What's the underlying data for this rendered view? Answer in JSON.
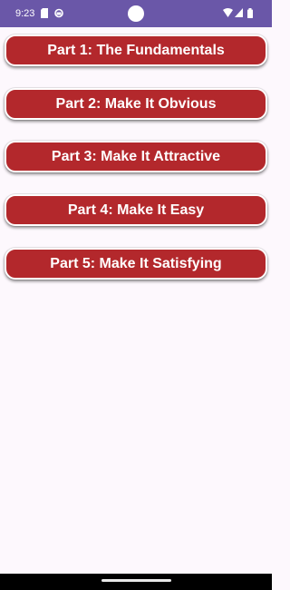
{
  "status_bar": {
    "time": "9:23",
    "background_color": "#6a57a8",
    "icons": [
      "sim-card-icon",
      "sync-icon",
      "wifi-icon",
      "signal-icon",
      "battery-icon"
    ]
  },
  "chapters": [
    {
      "label": "Part 1: The Fundamentals"
    },
    {
      "label": "Part 2: Make It Obvious"
    },
    {
      "label": "Part 3: Make It Attractive"
    },
    {
      "label": "Part 4: Make It Easy"
    },
    {
      "label": "Part 5: Make It Satisfying"
    }
  ],
  "colors": {
    "button_background": "#b3282c",
    "button_text": "#ffffff",
    "page_background": "#fdf8fd"
  }
}
